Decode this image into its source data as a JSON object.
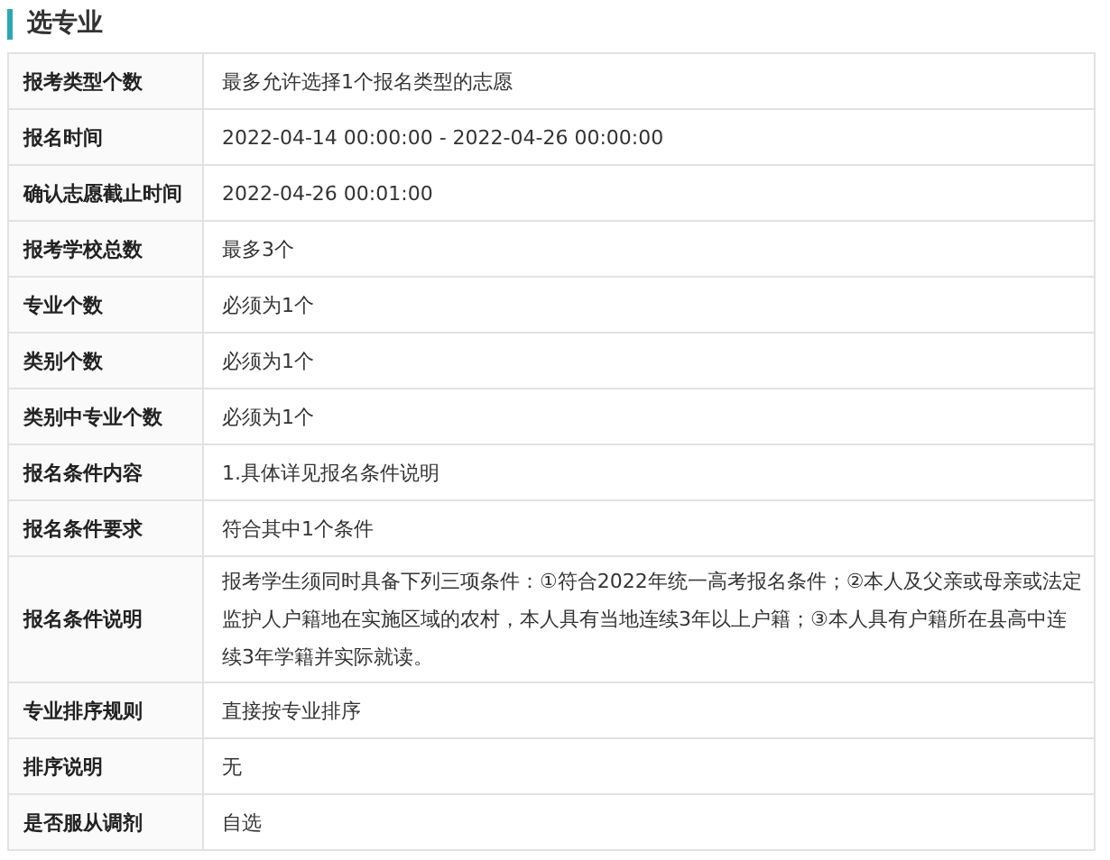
{
  "section": {
    "title": "选专业"
  },
  "rows": [
    {
      "label": "报考类型个数",
      "value": "最多允许选择1个报名类型的志愿"
    },
    {
      "label": "报名时间",
      "value": "2022-04-14 00:00:00 - 2022-04-26 00:00:00"
    },
    {
      "label": "确认志愿截止时间",
      "value": "2022-04-26 00:01:00"
    },
    {
      "label": "报考学校总数",
      "value": "最多3个"
    },
    {
      "label": "专业个数",
      "value": "必须为1个"
    },
    {
      "label": "类别个数",
      "value": "必须为1个"
    },
    {
      "label": "类别中专业个数",
      "value": "必须为1个"
    },
    {
      "label": "报名条件内容",
      "value": "1.具体详见报名条件说明"
    },
    {
      "label": "报名条件要求",
      "value": "符合其中1个条件"
    },
    {
      "label": "报名条件说明",
      "value": "报考学生须同时具备下列三项条件：①符合2022年统一高考报名条件；②本人及父亲或母亲或法定监护人户籍地在实施区域的农村，本人具有当地连续3年以上户籍；③本人具有户籍所在县高中连续3年学籍并实际就读。"
    },
    {
      "label": "专业排序规则",
      "value": "直接按专业排序"
    },
    {
      "label": "排序说明",
      "value": "无"
    },
    {
      "label": "是否服从调剂",
      "value": "自选"
    }
  ]
}
